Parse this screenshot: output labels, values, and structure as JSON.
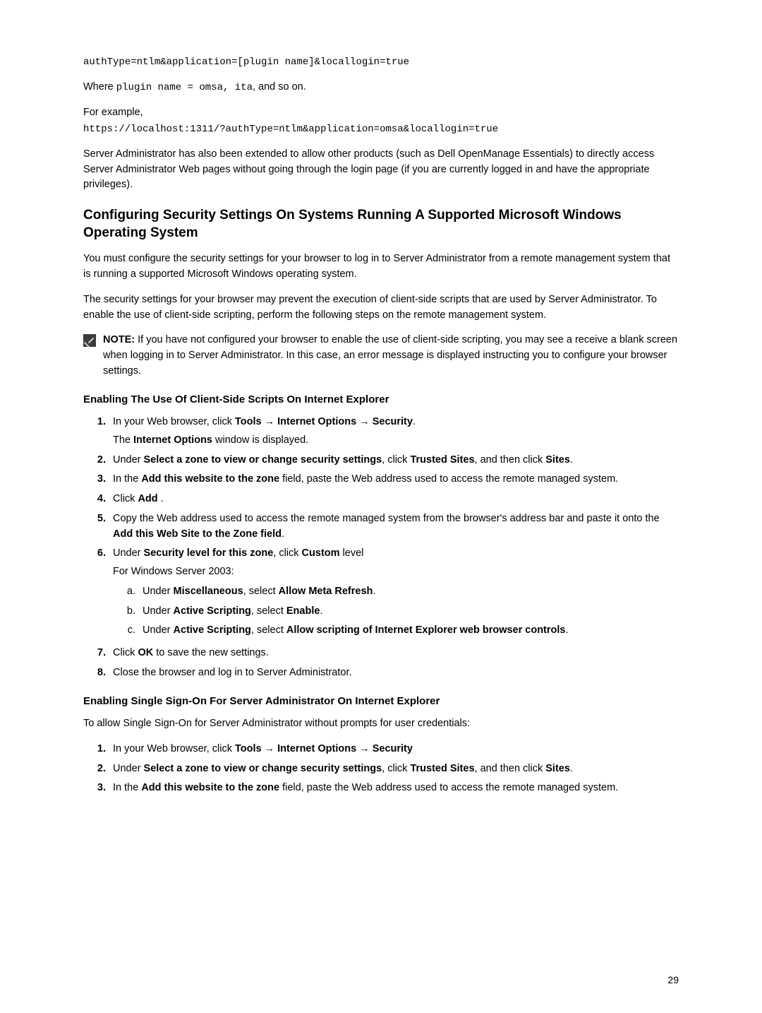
{
  "code1": "authType=ntlm&application=[plugin name]&locallogin=true",
  "where_a": "Where ",
  "where_b": "plugin name = omsa, ita",
  "where_c": ", and so on.",
  "forex": "For example,",
  "code2": "https://localhost:1311/?authType=ntlm&application=omsa&locallogin=true",
  "p1": "Server Administrator has also been extended to allow other products (such as Dell OpenManage Essentials) to directly access Server Administrator Web pages without going through the login page (if you are currently logged in and have the appropriate privileges).",
  "h2": "Configuring Security Settings On Systems Running A Supported Microsoft Windows Operating System",
  "p2": "You must configure the security settings for your browser to log in to Server Administrator from a remote management system that is running a supported Microsoft Windows operating system.",
  "p3": "The security settings for your browser may prevent the execution of client-side scripts that are used by Server Administrator. To enable the use of client-side scripting, perform the following steps on the remote management system.",
  "note_label": "NOTE: ",
  "note_body": "If you have not configured your browser to enable the use of client-side scripting, you may see a receive a blank screen when logging in to Server Administrator. In this case, an error message is displayed instructing you to configure your browser settings.",
  "h3a": "Enabling The Use Of Client-Side Scripts On Internet Explorer",
  "a1_a": "In your Web browser, click ",
  "a1_b": "Tools",
  "a1_c": " → ",
  "a1_d": "Internet Options",
  "a1_e": " → ",
  "a1_f": "Security",
  "a1_g": ".",
  "a1_sub_a": "The ",
  "a1_sub_b": "Internet Options",
  "a1_sub_c": " window is displayed.",
  "a2_a": "Under ",
  "a2_b": "Select a zone to view or change security settings",
  "a2_c": ", click ",
  "a2_d": "Trusted Sites",
  "a2_e": ", and then click ",
  "a2_f": "Sites",
  "a2_g": ".",
  "a3_a": "In the ",
  "a3_b": "Add this website to the zone",
  "a3_c": " field, paste the Web address used to access the remote managed system.",
  "a4_a": "Click ",
  "a4_b": "Add",
  "a4_c": " .",
  "a5_a": "Copy the Web address used to access the remote managed system from the browser's address bar and paste it onto the ",
  "a5_b": "Add this Web Site to the Zone field",
  "a5_c": ".",
  "a6_a": "Under ",
  "a6_b": "Security level for this zone",
  "a6_c": ", click ",
  "a6_d": "Custom",
  "a6_e": " level",
  "a6_sub": "For Windows Server 2003:",
  "a6a_a": "Under ",
  "a6a_b": "Miscellaneous",
  "a6a_c": ", select ",
  "a6a_d": "Allow Meta Refresh",
  "a6a_e": ".",
  "a6b_a": "Under ",
  "a6b_b": "Active Scripting",
  "a6b_c": ", select ",
  "a6b_d": "Enable",
  "a6b_e": ".",
  "a6c_a": "Under ",
  "a6c_b": "Active Scripting",
  "a6c_c": ", select ",
  "a6c_d": "Allow scripting of Internet Explorer web browser controls",
  "a6c_e": ".",
  "a7_a": "Click ",
  "a7_b": "OK",
  "a7_c": " to save the new settings.",
  "a8": "Close the browser and log in to Server Administrator.",
  "h3b": "Enabling Single Sign-On For Server Administrator On Internet Explorer",
  "p4": "To allow Single Sign-On for Server Administrator without prompts for user credentials:",
  "b1_a": "In your Web browser, click ",
  "b1_b": "Tools",
  "b1_c": " → ",
  "b1_d": "Internet Options",
  "b1_e": " → ",
  "b1_f": "Security",
  "b2_a": "Under ",
  "b2_b": "Select a zone to view or change security settings",
  "b2_c": ", click ",
  "b2_d": "Trusted Sites",
  "b2_e": ", and then click ",
  "b2_f": "Sites",
  "b2_g": ".",
  "b3_a": "In the ",
  "b3_b": "Add this website to the zone",
  "b3_c": " field, paste the Web address used to access the remote managed system.",
  "pagenum": "29"
}
